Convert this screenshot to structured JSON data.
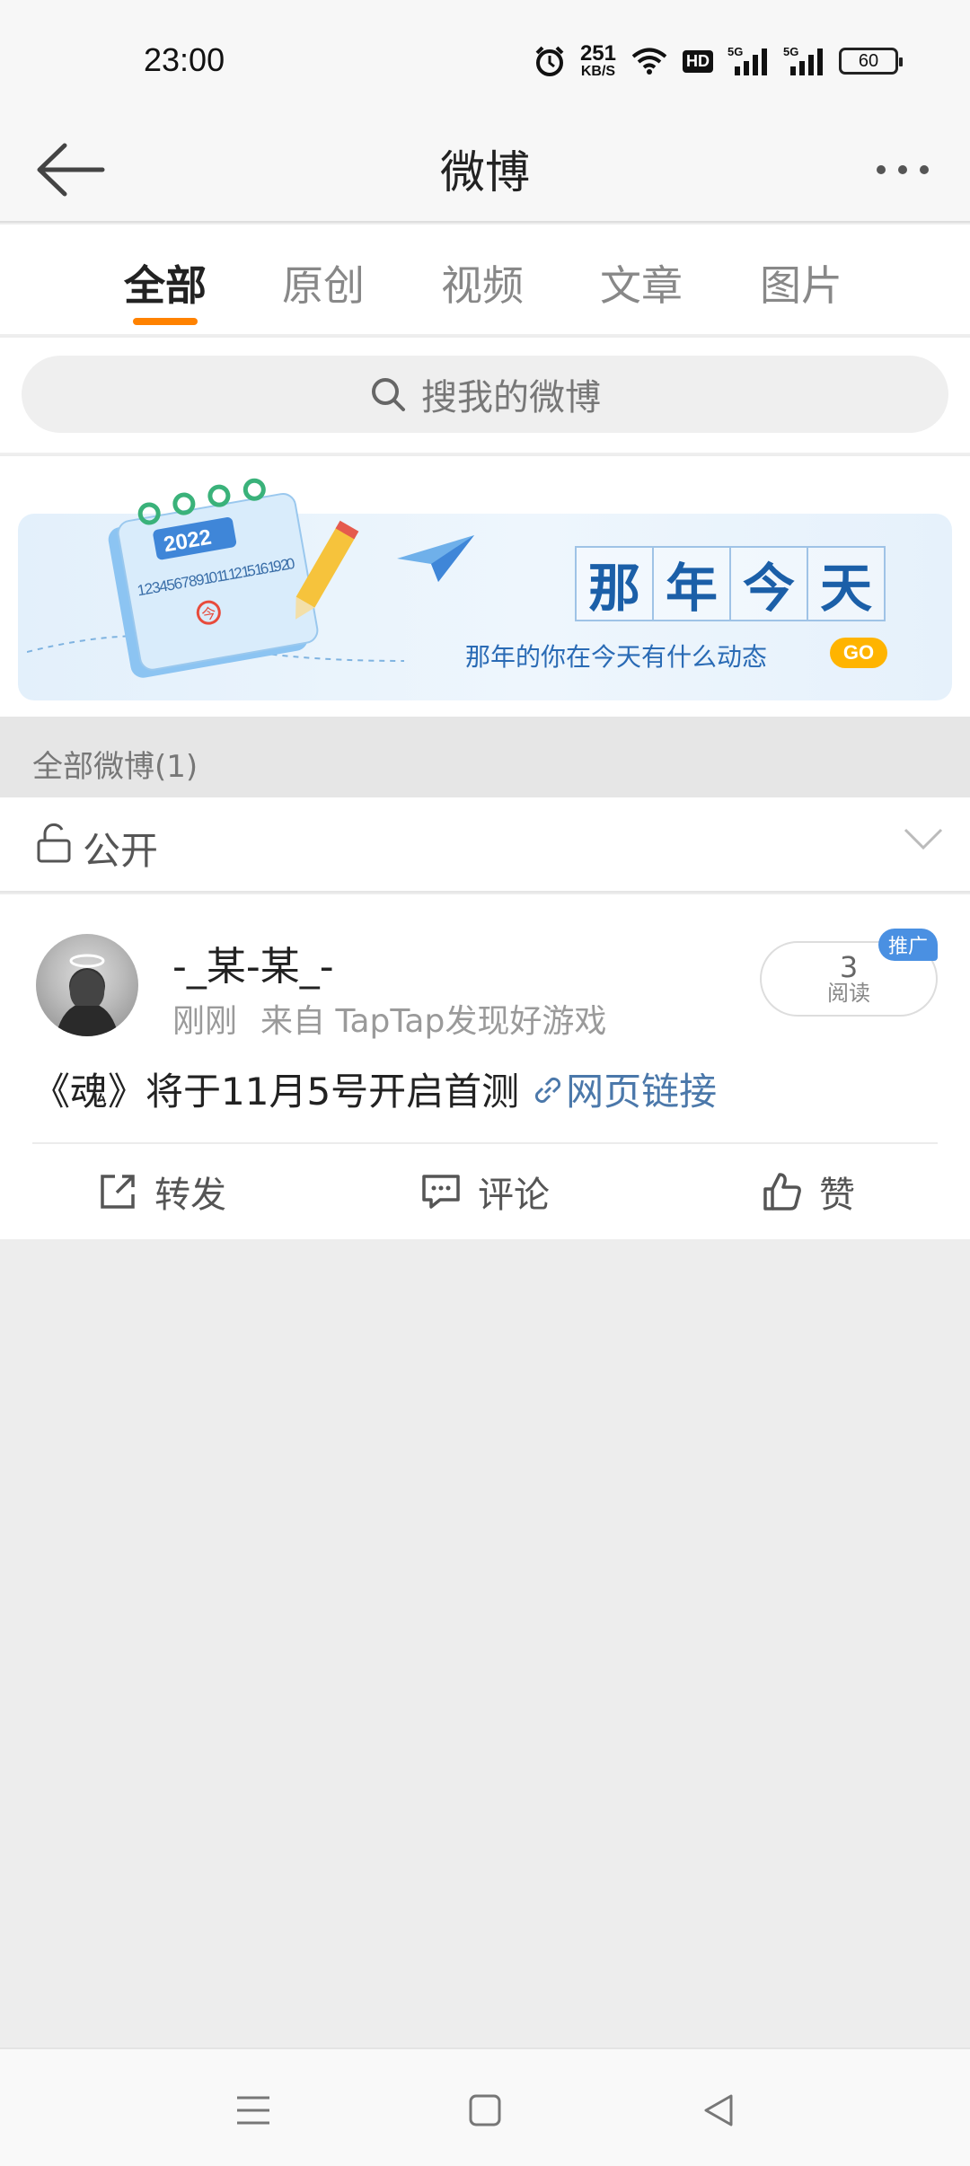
{
  "status_bar": {
    "time": "23:00",
    "net_speed_value": "251",
    "net_speed_unit": "KB/S",
    "hd_label": "HD",
    "network_label": "5G",
    "battery_level": "60"
  },
  "nav": {
    "title": "微博"
  },
  "tabs": [
    {
      "label": "全部",
      "active": true
    },
    {
      "label": "原创",
      "active": false
    },
    {
      "label": "视频",
      "active": false
    },
    {
      "label": "文章",
      "active": false
    },
    {
      "label": "图片",
      "active": false
    }
  ],
  "search": {
    "placeholder": "搜我的微博"
  },
  "banner": {
    "year_text": "2022",
    "calendar_numbers": "1 2 3 4 5 6 7 8 9 10 11 12 15 16 19 20",
    "calendar_today": "今",
    "title_chars": [
      "那",
      "年",
      "今",
      "天"
    ],
    "subtitle": "那年的你在今天有什么动态",
    "go_label": "GO"
  },
  "section": {
    "header": "全部微博(1)"
  },
  "filter": {
    "visibility_label": "公开"
  },
  "post": {
    "username": "-_某-某_-",
    "time": "刚刚",
    "source": "来自 TapTap发现好游戏",
    "read_count": "3",
    "read_label": "阅读",
    "promo_label": "推广",
    "text": "《魂》将于11月5号开启首测",
    "link_label": "网页链接",
    "actions": {
      "repost": "转发",
      "comment": "评论",
      "like": "赞"
    }
  },
  "colors": {
    "accent": "#ff8200",
    "link": "#4b78aa",
    "badge": "#4a90e2",
    "banner_text": "#1b5fa8"
  }
}
